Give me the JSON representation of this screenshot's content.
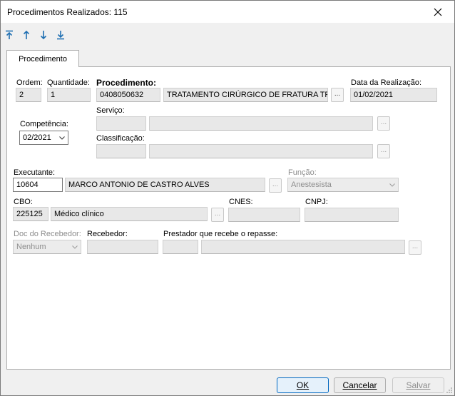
{
  "window": {
    "title": "Procedimentos Realizados: 115"
  },
  "toolbar": {
    "icons": [
      "first-record-icon",
      "previous-record-icon",
      "next-record-icon",
      "last-record-icon"
    ]
  },
  "tabs": [
    {
      "label": "Procedimento"
    }
  ],
  "form": {
    "ordem": {
      "label": "Ordem:",
      "value": "2"
    },
    "quantidade": {
      "label": "Quantidade:",
      "value": "1"
    },
    "procedimento": {
      "label": "Procedimento:",
      "code": "0408050632",
      "description": "TRATAMENTO CIRÚRGICO DE FRATURA TF"
    },
    "data_realizacao": {
      "label": "Data da Realização:",
      "value": "01/02/2021"
    },
    "competencia": {
      "label": "Competência:",
      "value": "02/2021"
    },
    "servico": {
      "label": "Serviço:",
      "code": "",
      "description": ""
    },
    "classificacao": {
      "label": "Classificação:",
      "code": "",
      "description": ""
    },
    "executante": {
      "label": "Executante:",
      "code": "10604",
      "name": "MARCO ANTONIO DE CASTRO ALVES"
    },
    "funcao": {
      "label": "Função:",
      "value": "Anestesista"
    },
    "cbo": {
      "label": "CBO:",
      "code": "225125",
      "description": "Médico clínico"
    },
    "cnes": {
      "label": "CNES:",
      "value": ""
    },
    "cnpj": {
      "label": "CNPJ:",
      "value": ""
    },
    "doc_recebedor": {
      "label": "Doc do Recebedor:",
      "value": "Nenhum"
    },
    "recebedor": {
      "label": "Recebedor:",
      "value": ""
    },
    "prestador": {
      "label": "Prestador que recebe o repasse:",
      "code": "",
      "name": ""
    },
    "ellipsis": "..."
  },
  "buttons": {
    "ok": "OK",
    "cancel": "Cancelar",
    "save": "Salvar"
  },
  "colors": {
    "accent": "#0067c0",
    "toolbar_icon": "#1f6fb2",
    "field_bg": "#e8e8e8"
  }
}
